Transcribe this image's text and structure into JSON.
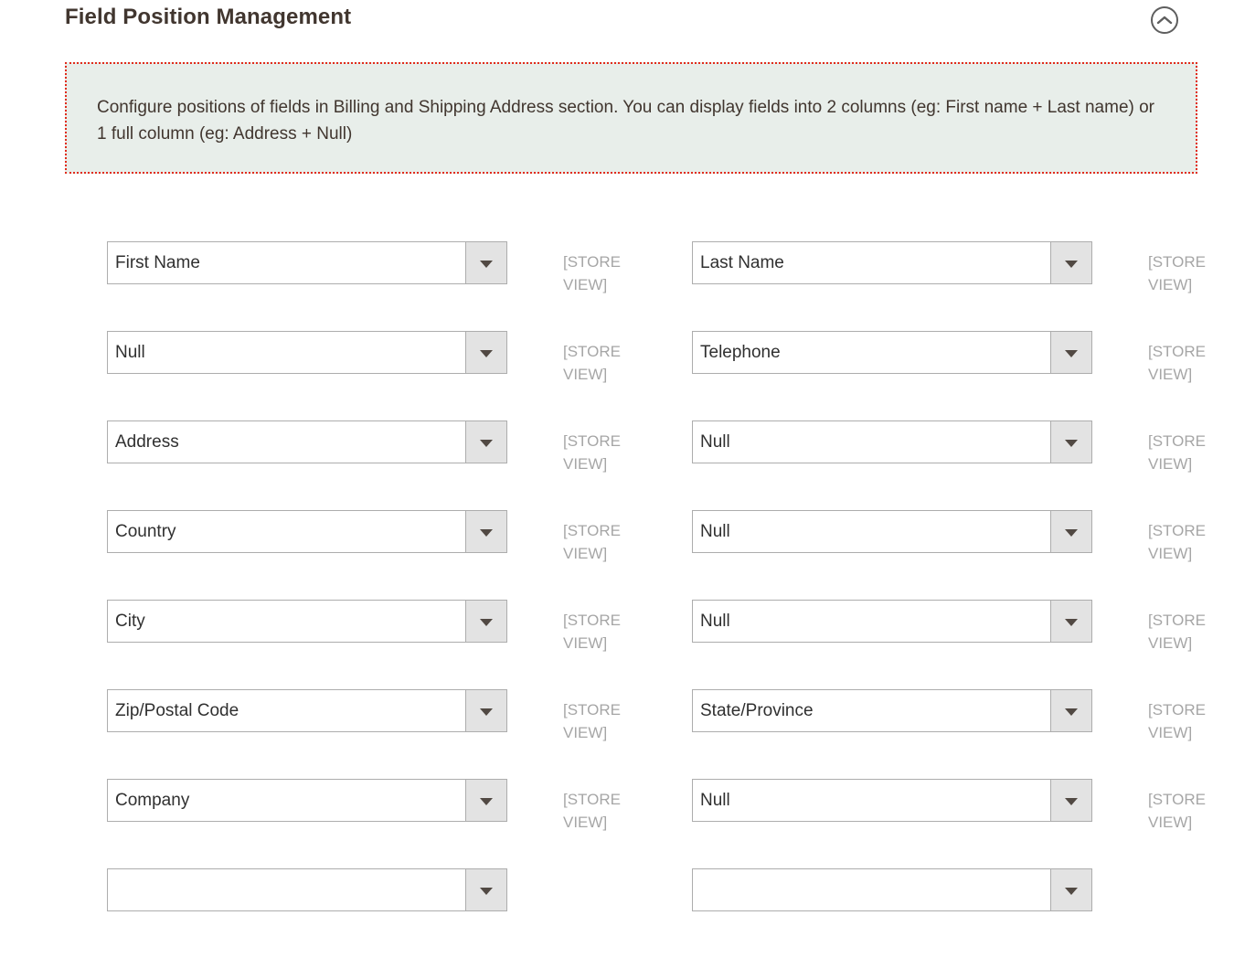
{
  "header": {
    "title": "Field Position Management",
    "collapse_icon": "chevron-up-icon"
  },
  "notice": {
    "text": "Configure positions of fields in Billing and Shipping Address section. You can display fields into 2 columns (eg: First name + Last name) or 1 full column (eg: Address + Null)",
    "background_color": "#e8eeea",
    "border_color": "#e12c1c"
  },
  "scope_label": "[STORE VIEW]",
  "colors": {
    "title": "#41362f",
    "select_border": "#adadad",
    "select_button": "#e3e3e3",
    "arrow": "#514943",
    "scope_text": "#a6a6a6"
  },
  "rows": [
    {
      "left": {
        "value": "First Name",
        "scope": "[STORE VIEW]"
      },
      "right": {
        "value": "Last Name",
        "scope": "[STORE VIEW]"
      }
    },
    {
      "left": {
        "value": "Null",
        "scope": "[STORE VIEW]"
      },
      "right": {
        "value": "Telephone",
        "scope": "[STORE VIEW]"
      }
    },
    {
      "left": {
        "value": "Address",
        "scope": "[STORE VIEW]"
      },
      "right": {
        "value": "Null",
        "scope": "[STORE VIEW]"
      }
    },
    {
      "left": {
        "value": "Country",
        "scope": "[STORE VIEW]"
      },
      "right": {
        "value": "Null",
        "scope": "[STORE VIEW]"
      }
    },
    {
      "left": {
        "value": "City",
        "scope": "[STORE VIEW]"
      },
      "right": {
        "value": "Null",
        "scope": "[STORE VIEW]"
      }
    },
    {
      "left": {
        "value": "Zip/Postal Code",
        "scope": "[STORE VIEW]"
      },
      "right": {
        "value": "State/Province",
        "scope": "[STORE VIEW]"
      }
    },
    {
      "left": {
        "value": "Company",
        "scope": "[STORE VIEW]"
      },
      "right": {
        "value": "Null",
        "scope": "[STORE VIEW]"
      }
    },
    {
      "left": {
        "value": "",
        "scope": ""
      },
      "right": {
        "value": "",
        "scope": ""
      }
    }
  ]
}
